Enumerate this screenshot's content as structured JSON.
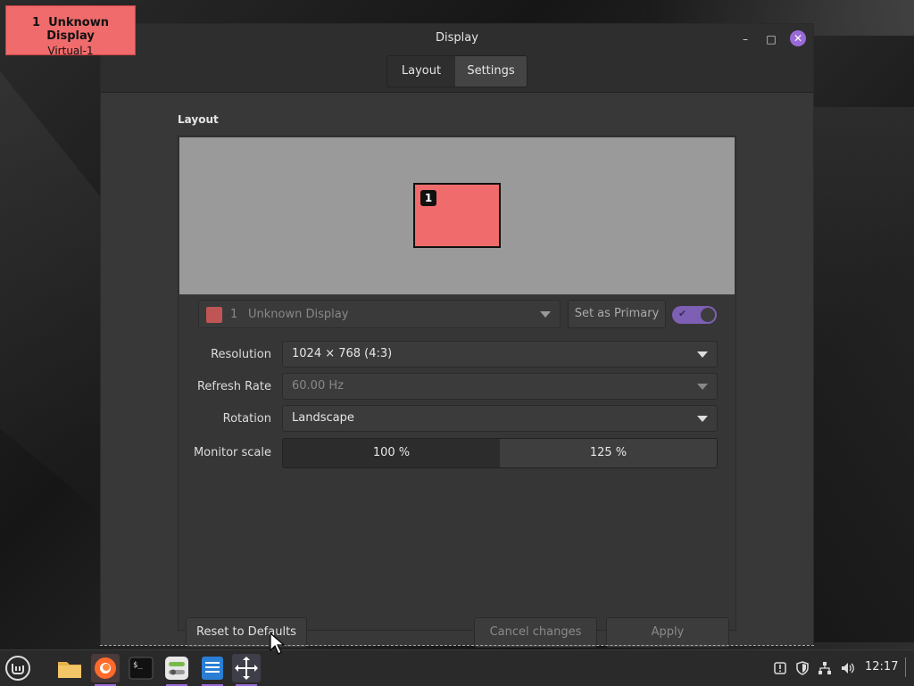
{
  "osd": {
    "number": "1",
    "name": "Unknown Display",
    "output": "Virtual-1"
  },
  "window": {
    "title": "Display",
    "controls": {
      "minimize": "–",
      "maximize": "□",
      "close": "✕"
    },
    "tabs": [
      {
        "label": "Layout",
        "active": false
      },
      {
        "label": "Settings",
        "active": true
      }
    ]
  },
  "layout": {
    "section_title": "Layout",
    "monitor_badge": "1",
    "display_select": {
      "number": "1",
      "name": "Unknown Display"
    },
    "set_primary_label": "Set as Primary",
    "enabled": true
  },
  "settings": {
    "resolution": {
      "label": "Resolution",
      "value": "1024 × 768 (4:3)"
    },
    "refresh_rate": {
      "label": "Refresh Rate",
      "value": "60.00 Hz"
    },
    "rotation": {
      "label": "Rotation",
      "value": "Landscape"
    },
    "monitor_scale": {
      "label": "Monitor scale",
      "options": [
        "100 %",
        "125 %"
      ],
      "selected": "100 %"
    }
  },
  "buttons": {
    "reset": "Reset to Defaults",
    "cancel": "Cancel changes",
    "apply": "Apply"
  },
  "taskbar": {
    "icons": [
      "mint-menu-icon",
      "folder-icon",
      "firefox-icon",
      "terminal-icon",
      "settings-icon",
      "text-editor-icon",
      "display-move-icon"
    ],
    "clock": "12:17"
  },
  "colors": {
    "accent": "#9a6ad8",
    "monitor": "#f06b6b"
  }
}
